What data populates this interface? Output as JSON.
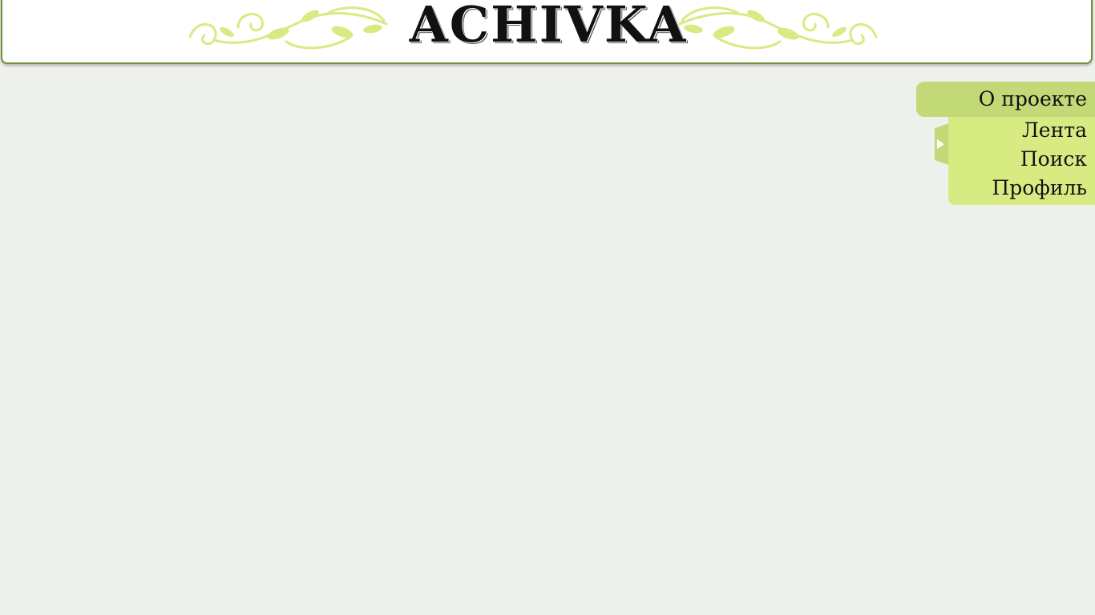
{
  "header": {
    "logo_text": "ACHIVKA",
    "accent_color": "#d8ea82",
    "border_color": "#6f8f3a"
  },
  "nav": {
    "active": {
      "label": "О проекте",
      "color": "#c3d876"
    },
    "items": [
      {
        "label": "Лента"
      },
      {
        "label": "Поиск"
      },
      {
        "label": "Профиль"
      }
    ],
    "toggle_icon": "play-right-icon"
  }
}
